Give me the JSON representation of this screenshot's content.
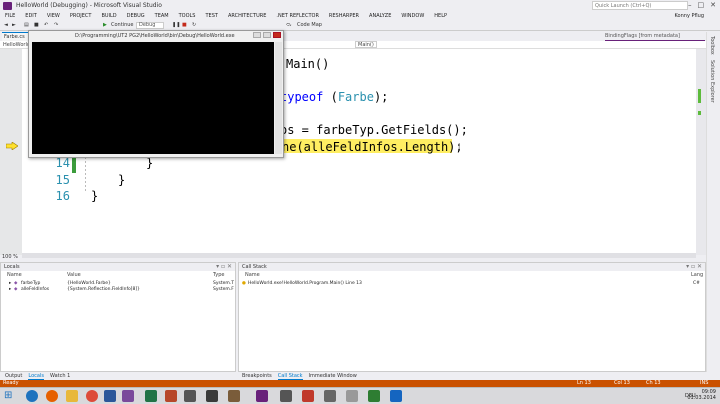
{
  "window": {
    "title": "HelloWorld (Debugging) - Microsoft Visual Studio",
    "quick_launch": "Quick Launch (Ctrl+Q)",
    "user": "Konny Pflug"
  },
  "menu": [
    "FILE",
    "EDIT",
    "VIEW",
    "PROJECT",
    "BUILD",
    "DEBUG",
    "TEAM",
    "TOOLS",
    "TEST",
    "ARCHITECTURE",
    ".NET REFLECTOR",
    "RESHARPER",
    "ANALYZE",
    "WINDOW",
    "HELP"
  ],
  "toolbar": {
    "continue_label": "Continue",
    "config": "Debug",
    "code_map": "Code Map"
  },
  "tabs": {
    "active": "Farbe.cs",
    "metadata": "BindingFlags [from metadata]"
  },
  "navbar": {
    "left": "HelloWorld",
    "right": "Main()"
  },
  "console": {
    "title": "D:\\Programming\\UT2 PG2\\HelloWorld\\bin\\Debug\\HelloWorld.exe"
  },
  "code": {
    "line_main": "Main()",
    "line_typeof": "typeof (Farbe);",
    "line_getfields": "os = farbeTyp.GetFields();",
    "line_highlight": "ne(alleFeldInfos.Length);",
    "brace1": "}",
    "brace2": "}",
    "brace3": "}",
    "numbers": [
      "14",
      "15",
      "16"
    ]
  },
  "zoom": "100 %",
  "locals": {
    "title": "Locals",
    "headers": [
      "Name",
      "Value",
      "Type"
    ],
    "rows": [
      {
        "name": "farbeTyp",
        "value": "{HelloWorld.Farbe}",
        "type": "System.T"
      },
      {
        "name": "alleFeldInfos",
        "value": "{System.Reflection.FieldInfo[8]}",
        "type": "System.F"
      }
    ],
    "tabs": [
      "Output",
      "Locals",
      "Watch 1"
    ]
  },
  "callstack": {
    "title": "Call Stack",
    "headers": [
      "Name",
      "Lang"
    ],
    "rows": [
      {
        "name": "HelloWorld.exe!HelloWorld.Program.Main() Line 13",
        "lang": "C#"
      }
    ],
    "tabs": [
      "Breakpoints",
      "Call Stack",
      "Immediate Window"
    ]
  },
  "status": {
    "ready": "Ready",
    "ln": "Ln 13",
    "col": "Col 13",
    "ch": "Ch 13",
    "ins": "INS"
  },
  "taskbar": {
    "lang": "DEU",
    "time": "09:09",
    "date": "01.03.2014"
  },
  "colors": {
    "status_bar": "#ca5100",
    "highlight": "#ffee62",
    "keyword": "#0000ff",
    "type": "#2b91af"
  }
}
